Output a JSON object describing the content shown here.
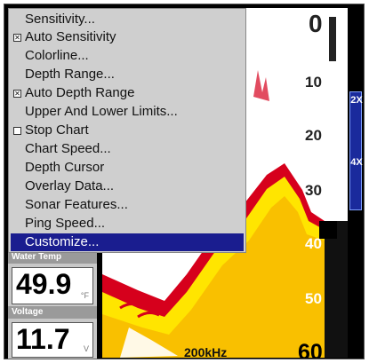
{
  "menu": {
    "items": [
      {
        "label": "Sensitivity...",
        "check": null
      },
      {
        "label": "Auto Sensitivity",
        "check": "checked"
      },
      {
        "label": "Colorline...",
        "check": null
      },
      {
        "label": "Depth Range...",
        "check": null
      },
      {
        "label": "Auto Depth Range",
        "check": "checked"
      },
      {
        "label": "Upper And Lower Limits...",
        "check": null
      },
      {
        "label": "Stop Chart",
        "check": "unchecked"
      },
      {
        "label": "Chart Speed...",
        "check": null
      },
      {
        "label": "Depth Cursor",
        "check": null
      },
      {
        "label": "Overlay Data...",
        "check": null
      },
      {
        "label": "Sonar Features...",
        "check": null
      },
      {
        "label": "Ping Speed...",
        "check": null
      },
      {
        "label": "Customize...",
        "check": null,
        "selected": true
      }
    ]
  },
  "water_temp": {
    "title": "Water Temp",
    "value": "49.9",
    "unit": "°F"
  },
  "voltage": {
    "title": "Voltage",
    "value": "11.7",
    "unit": "V"
  },
  "sonar": {
    "frequency": "200kHz",
    "depth_labels": [
      "0",
      "10",
      "20",
      "30",
      "40",
      "50",
      "60"
    ],
    "zoom": [
      "2X",
      "4X"
    ]
  },
  "colors": {
    "menu_bg": "#cfcfcf",
    "selected": "#1a1d8f",
    "return_yellow": "#ffe500",
    "return_red": "#d6001c",
    "zoom_bar": "#1a2a9c"
  }
}
